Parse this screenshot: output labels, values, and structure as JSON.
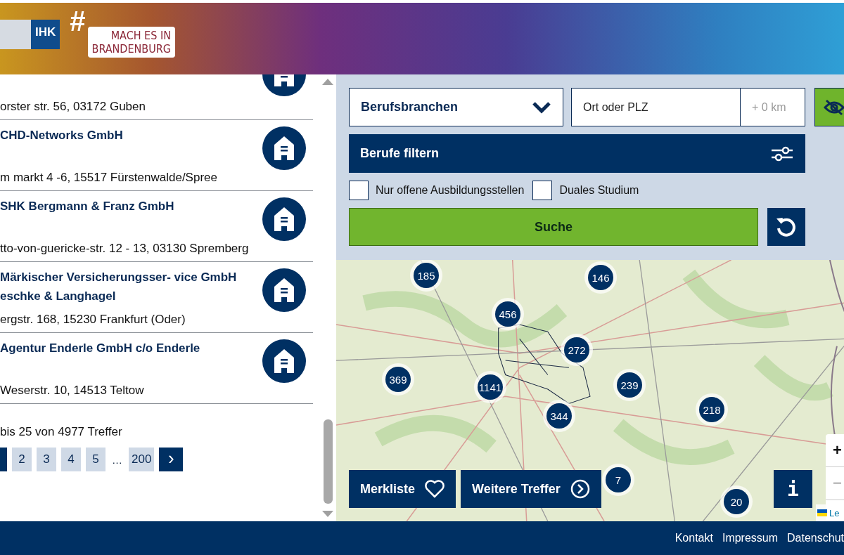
{
  "header": {
    "logo_text": "IHK",
    "campaign_hash": "#",
    "campaign_lines": [
      "MACH ES IN",
      "BRANDENBURG"
    ]
  },
  "results": [
    {
      "address": "orster str. 56, 03172 Guben"
    },
    {
      "name_lines": [
        "CHD-Networks GmbH"
      ],
      "address": "m markt 4 -6, 15517 Fürstenwalde/Spree"
    },
    {
      "name_lines": [
        "SHK Bergmann & Franz GmbH"
      ],
      "address": "tto-von-guericke-str. 12 - 13, 03130 Spremberg"
    },
    {
      "name_lines": [
        "Märkischer Versicherungsser- vice GmbH",
        "eschke & Langhagel"
      ],
      "address": "ergstr. 168, 15230 Frankfurt (Oder)"
    },
    {
      "name_lines": [
        "Agentur Enderle GmbH c/o Enderle"
      ],
      "address": "Weserstr. 10, 14513 Teltow"
    }
  ],
  "summary": "bis 25 von 4977 Treffer",
  "pagination": {
    "pages": [
      {
        "label": "2",
        "selected": false
      },
      {
        "label": "3",
        "selected": false
      },
      {
        "label": "4",
        "selected": false
      },
      {
        "label": "5",
        "selected": false
      }
    ],
    "ellipsis": "…",
    "last": "200",
    "next": "›"
  },
  "search": {
    "branch_select": "Berufsbranchen",
    "location": {
      "placeholder": "Ort oder PLZ"
    },
    "radius": {
      "placeholder": "+ 0 km"
    },
    "filter_button": "Berufe filtern",
    "checkboxes": [
      {
        "label": "Nur offene Ausbildungsstellen",
        "checked": false
      },
      {
        "label": "Duales Studium",
        "checked": false
      }
    ],
    "search_button": "Suche"
  },
  "map": {
    "clusters": [
      {
        "count": "185"
      },
      {
        "count": "146"
      },
      {
        "count": "456"
      },
      {
        "count": "272"
      },
      {
        "count": "369"
      },
      {
        "count": "1141"
      },
      {
        "count": "239"
      },
      {
        "count": "344"
      },
      {
        "count": "218"
      },
      {
        "count": "7"
      },
      {
        "count": "20"
      }
    ],
    "favorites_button": "Merkliste",
    "more_button": "Weitere Treffer",
    "info_button": "i",
    "zoom_in": "+",
    "zoom_out": "−",
    "attribution": "Le"
  },
  "footer": {
    "links": [
      "Kontakt",
      "Impressum",
      "Datenschut"
    ]
  }
}
